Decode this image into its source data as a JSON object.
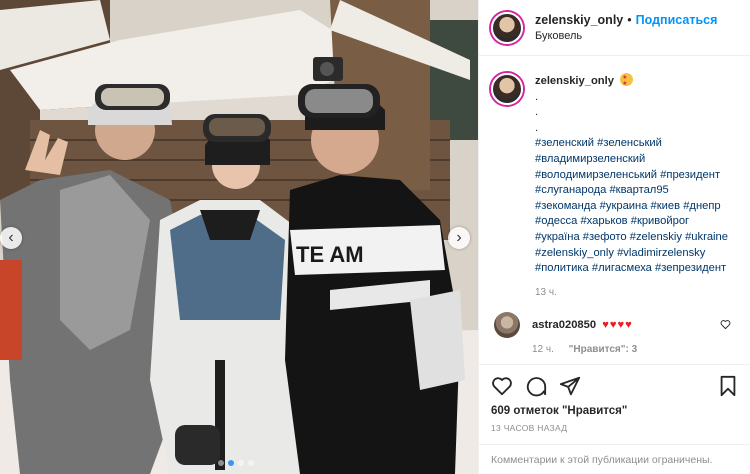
{
  "header": {
    "username": "zelenskiy_only",
    "separator": "•",
    "follow_label": "Подписаться",
    "location": "Буковель"
  },
  "caption": {
    "username": "zelenskiy_only",
    "emoji": "star-struck-emoji",
    "dots": [
      ".",
      ".",
      "."
    ],
    "hashtags": [
      "#зеленский #зеленський",
      "#владимирзеленский",
      "#володимирзеленський #президент",
      "#слуганарода #квартал95",
      "#зекоманда #украина #киев #днепр",
      "#одесса #харьков #кривойрог",
      "#україна #зефото #zelenskiy #ukraine",
      "#zelenskiy_only #vladimirzelensky",
      "#политика #лигасмеха #зепрезидент"
    ],
    "time": "13 ч."
  },
  "comment": {
    "username": "astra020850",
    "hearts": "♥♥♥♥",
    "time": "12 ч.",
    "likes": "\"Нравится\": 3"
  },
  "actions": {
    "likes_text": "609 отметок \"Нравится\"",
    "post_time": "13 ЧАСОВ НАЗАД",
    "restricted_text": "Комментарии к этой публикации ограничены."
  },
  "carousel": {
    "prev_icon": "chevron-left-icon",
    "next_icon": "chevron-right-icon",
    "slide_count": 4,
    "active_index": 1
  },
  "photo": {
    "jacket_text": "TE AM"
  },
  "colors": {
    "follow": "#0095f6",
    "hashtag": "#00376b",
    "muted": "#8e8e8e",
    "heart": "#ed1c24",
    "border": "#efefef"
  }
}
